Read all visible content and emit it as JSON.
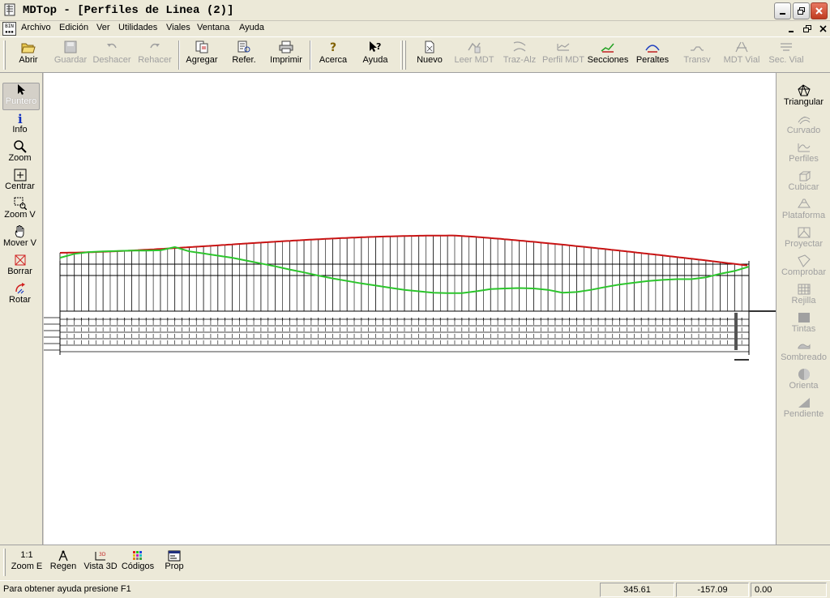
{
  "window": {
    "title": "MDTop - [Perfiles de Linea (2)]"
  },
  "menu": [
    "Archivo",
    "Edición",
    "Ver",
    "Utilidades",
    "Viales",
    "Ventana",
    "Ayuda"
  ],
  "toolbar": {
    "abrir": "Abrir",
    "guardar": "Guardar",
    "deshacer": "Deshacer",
    "rehacer": "Rehacer",
    "agregar": "Agregar",
    "refer": "Refer.",
    "imprimir": "Imprimir",
    "acerca": "Acerca",
    "ayuda": "Ayuda",
    "nuevo": "Nuevo",
    "leer_mdt": "Leer MDT",
    "traz_alz": "Traz-Alz",
    "perfil_mdt": "Perfil MDT",
    "secciones": "Secciones",
    "peraltes": "Peraltes",
    "transv": "Transv",
    "mdt_vial": "MDT Vial",
    "sec_vial": "Sec. Vial"
  },
  "left_tools": {
    "puntero": "Puntero",
    "info": "Info",
    "zoom": "Zoom",
    "centrar": "Centrar",
    "zoom_v": "Zoom V",
    "mover_v": "Mover V",
    "borrar": "Borrar",
    "rotar": "Rotar"
  },
  "right_tools": {
    "triangular": "Triangular",
    "curvado": "Curvado",
    "perfiles": "Perfiles",
    "cubicar": "Cubicar",
    "plataforma": "Plataforma",
    "proyectar": "Proyectar",
    "comprobar": "Comprobar",
    "rejilla": "Rejilla",
    "tintas": "Tintas",
    "sombreado": "Sombreado",
    "orienta": "Orienta",
    "pendiente": "Pendiente"
  },
  "bottom_tools": {
    "zoom_e_icon": "1:1",
    "zoom_e": "Zoom E",
    "regen": "Regen",
    "vista3d": "Vista 3D",
    "codigos": "Códigos",
    "prop": "Prop"
  },
  "status": {
    "help": "Para obtener ayuda presione F1",
    "x": "345.61",
    "y": "-157.09",
    "z": "0.00"
  },
  "profile": {
    "colors": {
      "terrain": "#2cc52c",
      "grade": "#c81414",
      "grid": "#000000"
    },
    "terrain_elevations": [
      5.2,
      6.3,
      6.8,
      7.0,
      7.1,
      7.2,
      7.2,
      7.3,
      8.2,
      7.0,
      6.4,
      5.8,
      5.2,
      4.4,
      3.6,
      2.8,
      1.9,
      1.1,
      0.2,
      -0.6,
      -1.3,
      -2.0,
      -2.6,
      -3.2,
      -3.8,
      -4.2,
      -4.6,
      -4.7,
      -4.7,
      -4.2,
      -3.6,
      -3.4,
      -3.3,
      -3.4,
      -3.8,
      -4.6,
      -4.4,
      -3.8,
      -3.0,
      -2.3,
      -1.8,
      -1.3,
      -1.0,
      -0.8,
      -0.8,
      -0.3,
      0.7,
      1.5,
      2.7
    ],
    "grade_elevations": [
      6.6,
      4.4,
      3.0
    ]
  }
}
